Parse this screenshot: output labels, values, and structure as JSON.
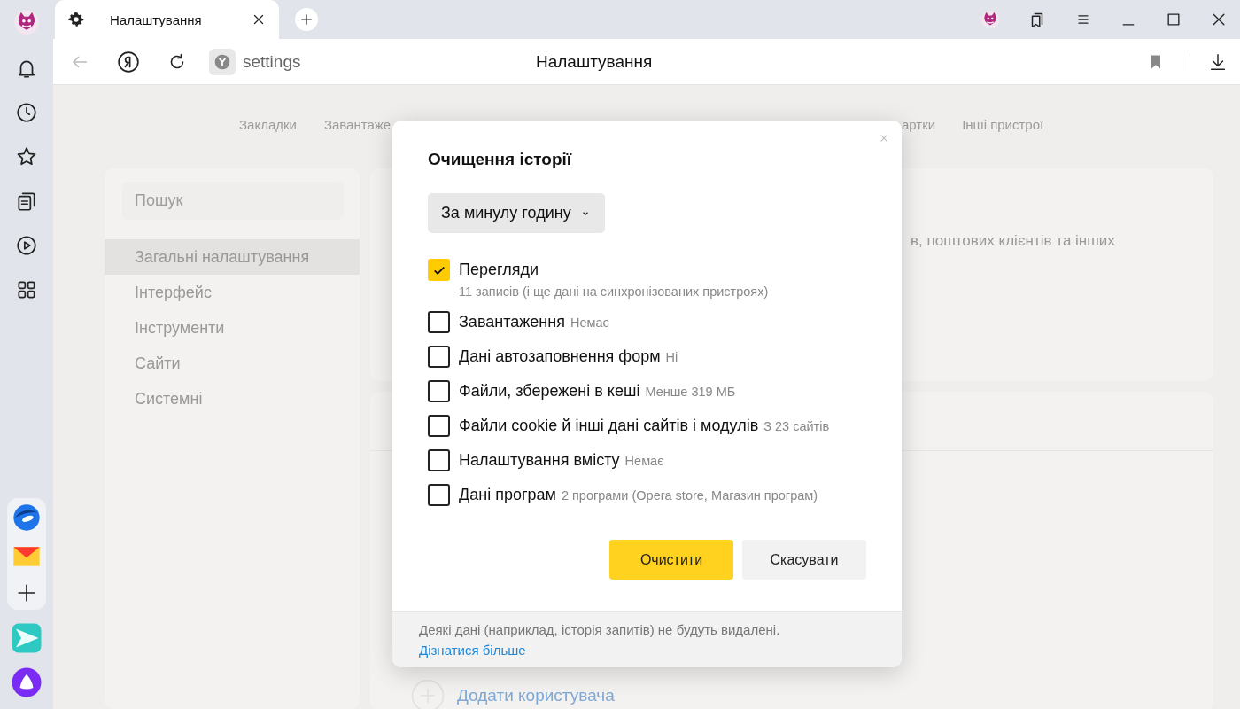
{
  "browser": {
    "tab": {
      "title": "Налаштування"
    },
    "address": {
      "host": "settings",
      "page_title": "Налаштування"
    }
  },
  "settings": {
    "nav": [
      {
        "label": "Закладки"
      },
      {
        "label": "Завантаже"
      },
      {
        "label": "артки"
      },
      {
        "label": "Інші пристрої"
      }
    ],
    "search": {
      "placeholder": "Пошук"
    },
    "sidebar": {
      "items": [
        {
          "label": "Загальні налаштування",
          "selected": true
        },
        {
          "label": "Інтерфейс",
          "selected": false
        },
        {
          "label": "Інструменти",
          "selected": false
        },
        {
          "label": "Сайти",
          "selected": false
        },
        {
          "label": "Системні",
          "selected": false
        }
      ]
    },
    "card_text": "в, поштових клієнтів та інших",
    "add_user": "Додати користувача"
  },
  "dialog": {
    "title": "Очищення історії",
    "period": "За минулу годину",
    "options": [
      {
        "label": "Перегляди",
        "detail": "11 записів (і ще дані на синхронізованих пристроях)",
        "checked": true,
        "kind": "stacked"
      },
      {
        "label": "Завантаження",
        "detail": "Немає",
        "checked": false,
        "kind": "inline"
      },
      {
        "label": "Дані автозаповнення форм",
        "detail": "Ні",
        "checked": false,
        "kind": "inline"
      },
      {
        "label": "Файли, збережені в кеші",
        "detail": "Менше 319 МБ",
        "checked": false,
        "kind": "inline"
      },
      {
        "label": "Файли cookie й інші дані сайтів і модулів",
        "detail": "З 23 сайтів",
        "checked": false,
        "kind": "inline"
      },
      {
        "label": "Налаштування вмісту",
        "detail": "Немає",
        "checked": false,
        "kind": "inline"
      },
      {
        "label": "Дані програм",
        "detail": "2 програми (Opera store, Магазин програм)",
        "checked": false,
        "kind": "inline"
      }
    ],
    "buttons": [
      {
        "label": "Очистити",
        "kind": "primary"
      },
      {
        "label": "Скасувати",
        "kind": "secondary"
      }
    ],
    "footer": {
      "note": "Деякі дані (наприклад, історія запитів) не будуть видалені.",
      "link": "Дізнатися більше"
    }
  }
}
